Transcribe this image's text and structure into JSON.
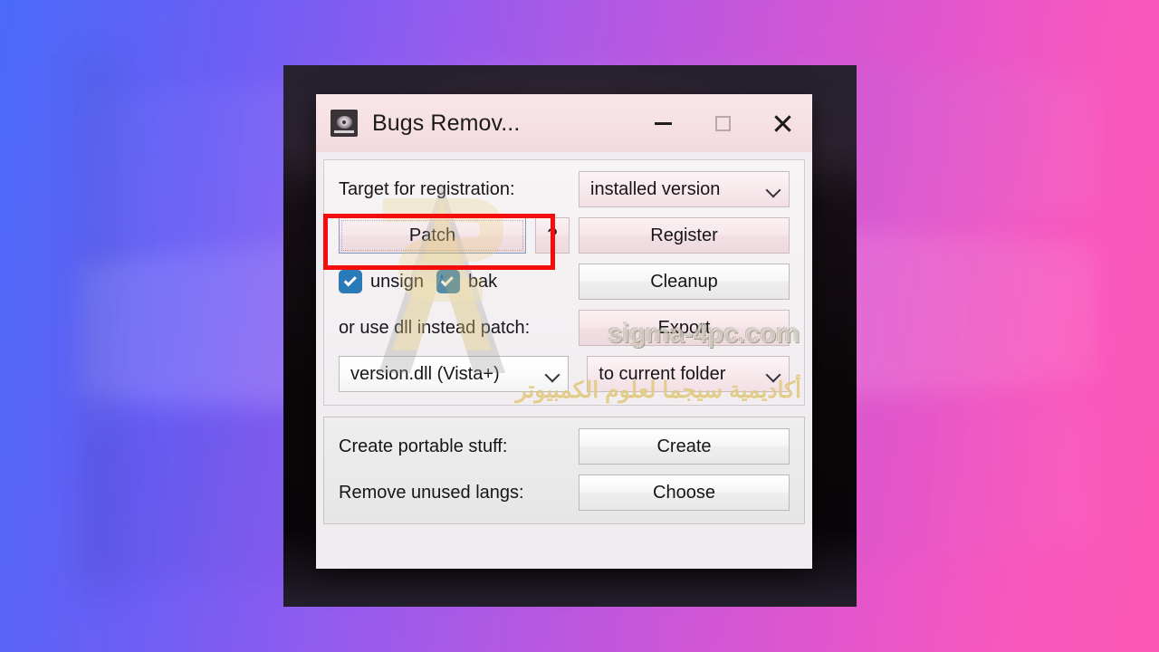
{
  "background": {
    "gradient_from": "#4a6bf8",
    "gradient_to": "#fe58b4"
  },
  "window": {
    "title": "Bugs Remov...",
    "icon": "disc-icon",
    "controls": {
      "minimize": "minimize-icon",
      "maximize": "maximize-icon",
      "close": "close-icon"
    }
  },
  "main_group": {
    "target_label": "Target for registration:",
    "target_value": "installed version",
    "patch_button": "Patch",
    "help_button": "?",
    "register_button": "Register",
    "unsign_label": "unsign",
    "bak_label": "bak",
    "cleanup_button": "Cleanup",
    "dll_label": "or use dll instead patch:",
    "export_button": "Export",
    "dll_value": "version.dll (Vista+)",
    "export_target_value": "to current folder"
  },
  "bottom_group": {
    "portable_label": "Create portable stuff:",
    "create_button": "Create",
    "langs_label": "Remove unused langs:",
    "choose_button": "Choose"
  },
  "annotation": {
    "highlight_color": "#f40d0d",
    "highlight_target": "Patch"
  },
  "watermark": {
    "site": "sigma-4pc.com",
    "arabic": "أكاديمية سيجما لعلوم الكمبيوتر"
  }
}
